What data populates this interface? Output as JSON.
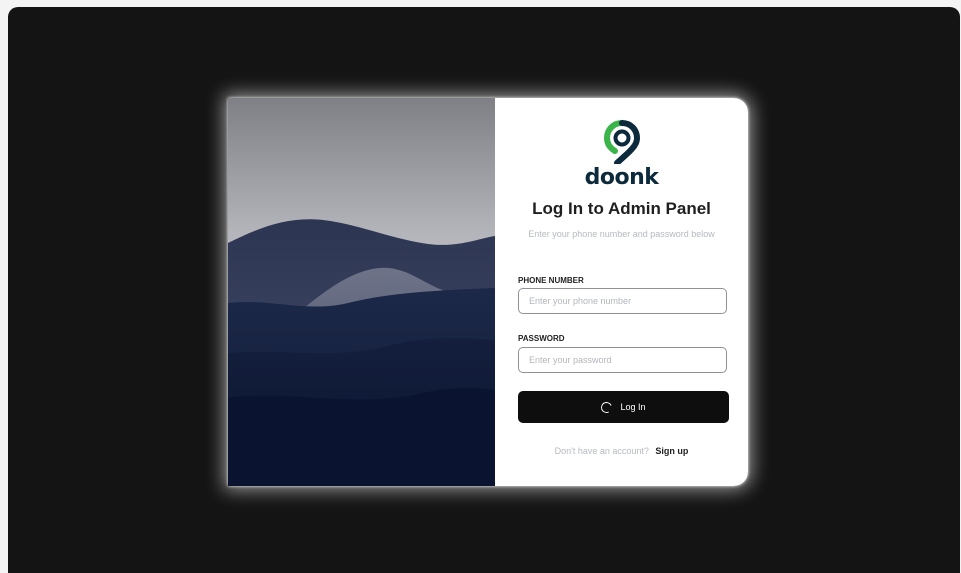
{
  "brand": {
    "name": "doonk",
    "logo_colors": {
      "green": "#3bb44a",
      "navy": "#0c2a3b"
    }
  },
  "login": {
    "title": "Log In to Admin Panel",
    "subtitle": "Enter your phone number and password below",
    "phone": {
      "label": "PHONE NUMBER",
      "placeholder": "Enter your phone number",
      "value": ""
    },
    "password": {
      "label": "PASSWORD",
      "placeholder": "Enter your password",
      "value": ""
    },
    "submit": {
      "label": "Log In",
      "loading": true,
      "icon": "spinner-icon"
    },
    "signup": {
      "prompt": "Don't have an account?",
      "link": "Sign up"
    }
  },
  "colors": {
    "page_background": "#141414",
    "button": "#0e0e0e",
    "illustration_sky": "#a9aab0",
    "illustration_hills": "#0b1630"
  }
}
